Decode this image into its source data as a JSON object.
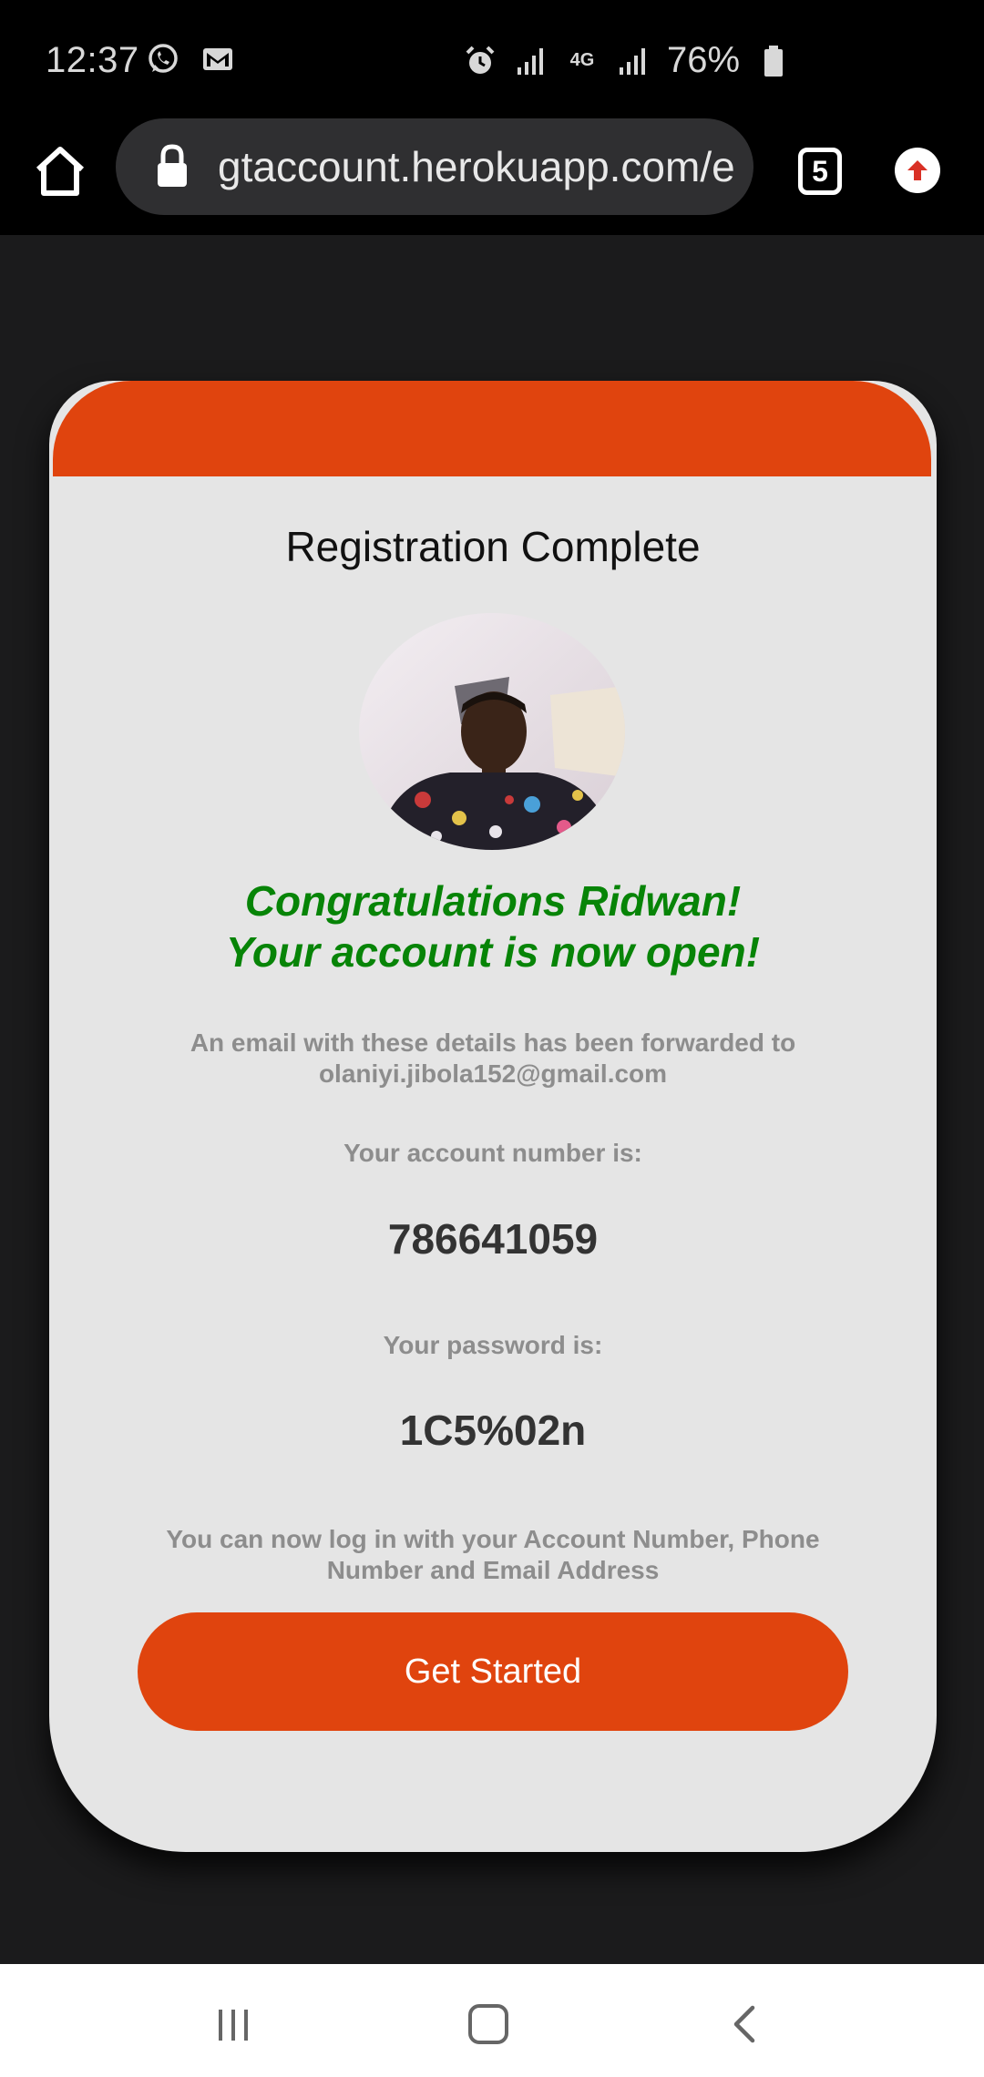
{
  "status_bar": {
    "time": "12:37",
    "battery": "76%",
    "network": "4G",
    "icons": [
      "whatsapp-icon",
      "gmail-icon",
      "alarm-icon",
      "signal-icon",
      "battery-icon"
    ]
  },
  "browser": {
    "url": "gtaccount.herokuapp.com/e",
    "tab_count": "5"
  },
  "card": {
    "title": "Registration Complete",
    "congrats_line1": "Congratulations Ridwan!",
    "congrats_line2": "Your account is now open!",
    "email_note_line1": "An email with these details has been forwarded to",
    "email_note_line2": "olaniyi.jibola152@gmail.com",
    "account_label": "Your account number is:",
    "account_number": "786641059",
    "password_label": "Your password is:",
    "password": "1C5%02n",
    "login_note_line1": "You can now log in with your Account Number, Phone",
    "login_note_line2": "Number and Email Address",
    "button_label": "Get Started"
  },
  "colors": {
    "brand": "#e0440e",
    "success": "#078407",
    "card_bg": "#e5e5e5",
    "page_bg": "#1b1b1c"
  }
}
